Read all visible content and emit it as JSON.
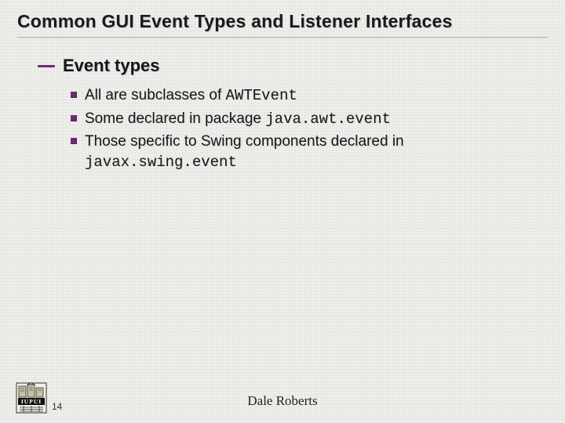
{
  "title": "Common GUI Event Types and Listener Interfaces",
  "section": {
    "heading": "Event types",
    "items": [
      {
        "prefix": "All are subclasses of ",
        "code": "AWTEvent",
        "suffix": ""
      },
      {
        "prefix": "Some declared in package ",
        "code": "java.awt.event",
        "suffix": ""
      },
      {
        "prefix": "Those specific to Swing components declared in ",
        "code": "javax.swing.event",
        "suffix": ""
      }
    ]
  },
  "footer": {
    "page": "14",
    "author": "Dale Roberts",
    "logo_label": "IUPUI"
  }
}
